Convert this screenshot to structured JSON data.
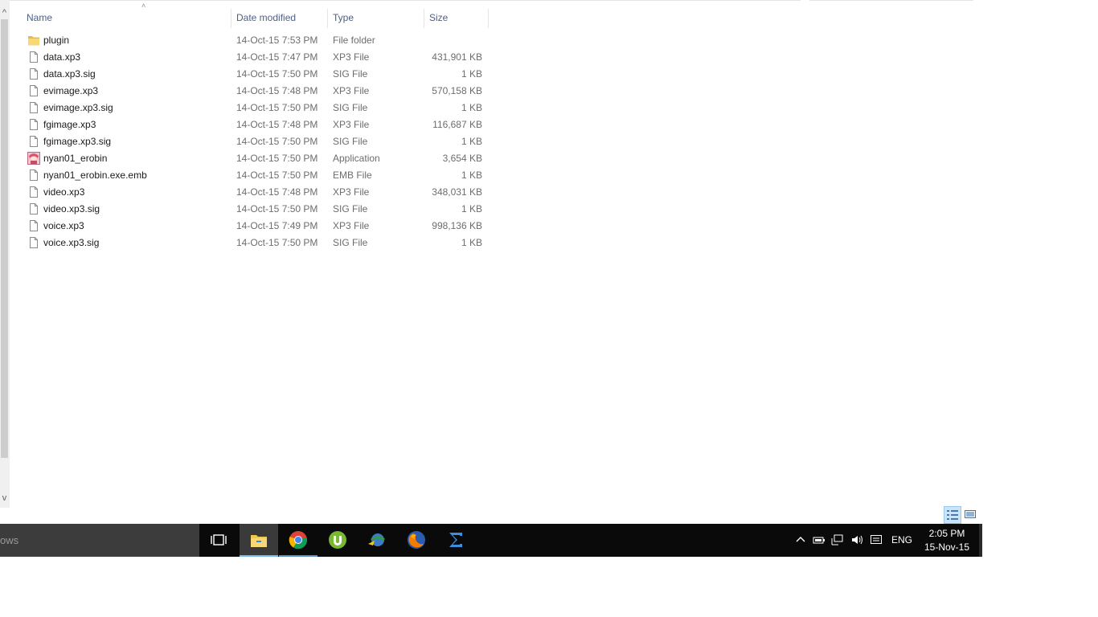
{
  "scrollbar": {
    "up_glyph": "^",
    "down_glyph": "v"
  },
  "columns": {
    "name": "Name",
    "date_modified": "Date modified",
    "type": "Type",
    "size": "Size"
  },
  "files": [
    {
      "name": "plugin",
      "date": "14-Oct-15 7:53 PM",
      "type": "File folder",
      "size": "",
      "icon": "folder-icon"
    },
    {
      "name": "data.xp3",
      "date": "14-Oct-15 7:47 PM",
      "type": "XP3 File",
      "size": "431,901 KB",
      "icon": "file-icon"
    },
    {
      "name": "data.xp3.sig",
      "date": "14-Oct-15 7:50 PM",
      "type": "SIG File",
      "size": "1 KB",
      "icon": "file-icon"
    },
    {
      "name": "evimage.xp3",
      "date": "14-Oct-15 7:48 PM",
      "type": "XP3 File",
      "size": "570,158 KB",
      "icon": "file-icon"
    },
    {
      "name": "evimage.xp3.sig",
      "date": "14-Oct-15 7:50 PM",
      "type": "SIG File",
      "size": "1 KB",
      "icon": "file-icon"
    },
    {
      "name": "fgimage.xp3",
      "date": "14-Oct-15 7:48 PM",
      "type": "XP3 File",
      "size": "116,687 KB",
      "icon": "file-icon"
    },
    {
      "name": "fgimage.xp3.sig",
      "date": "14-Oct-15 7:50 PM",
      "type": "SIG File",
      "size": "1 KB",
      "icon": "file-icon"
    },
    {
      "name": "nyan01_erobin",
      "date": "14-Oct-15 7:50 PM",
      "type": "Application",
      "size": "3,654 KB",
      "icon": "application-icon"
    },
    {
      "name": "nyan01_erobin.exe.emb",
      "date": "14-Oct-15 7:50 PM",
      "type": "EMB File",
      "size": "1 KB",
      "icon": "file-icon"
    },
    {
      "name": "video.xp3",
      "date": "14-Oct-15 7:48 PM",
      "type": "XP3 File",
      "size": "348,031 KB",
      "icon": "file-icon"
    },
    {
      "name": "video.xp3.sig",
      "date": "14-Oct-15 7:50 PM",
      "type": "SIG File",
      "size": "1 KB",
      "icon": "file-icon"
    },
    {
      "name": "voice.xp3",
      "date": "14-Oct-15 7:49 PM",
      "type": "XP3 File",
      "size": "998,136 KB",
      "icon": "file-icon"
    },
    {
      "name": "voice.xp3.sig",
      "date": "14-Oct-15 7:50 PM",
      "type": "SIG File",
      "size": "1 KB",
      "icon": "file-icon"
    }
  ],
  "taskbar": {
    "search_text": "ows",
    "apps": [
      {
        "name": "task-view-icon",
        "active": false
      },
      {
        "name": "file-explorer-icon",
        "active": true
      },
      {
        "name": "chrome-icon",
        "active": false
      },
      {
        "name": "utorrent-icon",
        "active": false
      },
      {
        "name": "internet-download-manager-icon",
        "active": false
      },
      {
        "name": "firefox-icon",
        "active": false
      },
      {
        "name": "sigma-app-icon",
        "active": false
      }
    ],
    "language": "ENG",
    "time": "2:05 PM",
    "date": "15-Nov-15"
  },
  "colors": {
    "header_text": "#4d6082",
    "taskbar_bg": "#0a0a0a",
    "search_bg": "#3c3c3c",
    "active_underline": "#76b9ed",
    "selected_view": "#cce4f7"
  }
}
